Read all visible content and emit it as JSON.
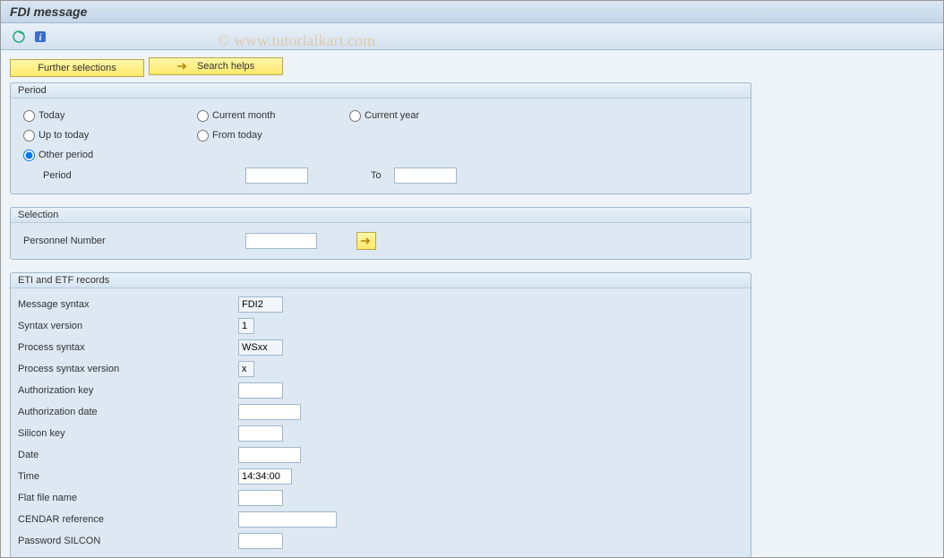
{
  "title": "FDI message",
  "watermark": "© www.tutorialkart.com",
  "buttons": {
    "further": "Further selections",
    "search": "Search helps"
  },
  "period": {
    "title": "Period",
    "today": "Today",
    "current_month": "Current month",
    "current_year": "Current year",
    "up_to_today": "Up to today",
    "from_today": "From today",
    "other_period": "Other period",
    "period_label": "Period",
    "to_label": "To",
    "period_from": "",
    "period_to": ""
  },
  "selection": {
    "title": "Selection",
    "personnel_label": "Personnel Number",
    "personnel_value": ""
  },
  "records": {
    "title": "ETI and ETF records",
    "rows": [
      {
        "label": "Message syntax",
        "value": "FDI2",
        "w": "w50",
        "pale": true
      },
      {
        "label": "Syntax version",
        "value": "1",
        "w": "w18",
        "pale": true
      },
      {
        "label": "Process syntax",
        "value": "WSxx",
        "w": "w50",
        "pale": true
      },
      {
        "label": "Process syntax version",
        "value": "x",
        "w": "w18",
        "pale": true
      },
      {
        "label": "Authorization key",
        "value": "",
        "w": "w50"
      },
      {
        "label": "Authorization date",
        "value": "",
        "w": "w70"
      },
      {
        "label": "Silicon key",
        "value": "",
        "w": "w50"
      },
      {
        "label": "Date",
        "value": "",
        "w": "w70"
      },
      {
        "label": "Time",
        "value": "14:34:00",
        "w": "w60"
      },
      {
        "label": "Flat file name",
        "value": "",
        "w": "w50"
      },
      {
        "label": "CENDAR reference",
        "value": "",
        "w": "w110"
      },
      {
        "label": "Password SILCON",
        "value": "",
        "w": "w50"
      }
    ]
  }
}
